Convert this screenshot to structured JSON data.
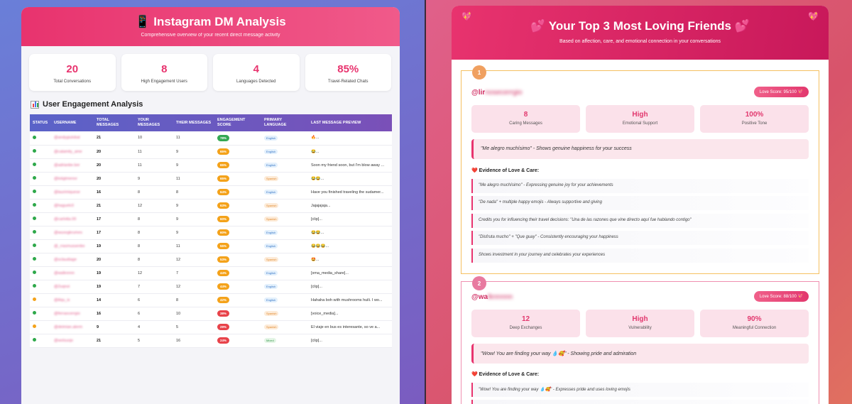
{
  "dm": {
    "title": "📱 Instagram DM Analysis",
    "subtitle": "Comprehensive overview of your recent direct message activity",
    "stats": [
      {
        "value": "20",
        "label": "Total Conversations"
      },
      {
        "value": "8",
        "label": "High Engagement Users"
      },
      {
        "value": "4",
        "label": "Languages Detected"
      },
      {
        "value": "85%",
        "label": "Travel-Related Chats"
      }
    ],
    "section_title": "User Engagement Analysis",
    "columns": [
      "STATUS",
      "USERNAME",
      "TOTAL MESSAGES",
      "YOUR MESSAGES",
      "THEIR MESSAGES",
      "ENGAGEMENT SCORE",
      "PRIMARY LANGUAGE",
      "LAST MESSAGE PREVIEW"
    ],
    "rows": [
      {
        "status": "#2ea84a",
        "username": "@andygiulobal",
        "total": "21",
        "yours": "10",
        "theirs": "11",
        "score": "78%",
        "score_color": "#34a853",
        "lang": "English",
        "preview": "🔥..."
      },
      {
        "status": "#2ea84a",
        "username": "@calamity_ame",
        "total": "20",
        "yours": "11",
        "theirs": "9",
        "score": "65%",
        "score_color": "#f4a21a",
        "lang": "English",
        "preview": "😂..."
      },
      {
        "status": "#2ea84a",
        "username": "@adrianbe.ber",
        "total": "20",
        "yours": "11",
        "theirs": "9",
        "score": "65%",
        "score_color": "#f4a21a",
        "lang": "English",
        "preview": "Soon my friend soon, but I'm blow away ..."
      },
      {
        "status": "#2ea84a",
        "username": "@toiigtmenor",
        "total": "20",
        "yours": "9",
        "theirs": "11",
        "score": "65%",
        "score_color": "#f4a21a",
        "lang": "Spanish",
        "preview": "😂😂..."
      },
      {
        "status": "#2ea84a",
        "username": "@laurimiquese",
        "total": "16",
        "yours": "8",
        "theirs": "8",
        "score": "64%",
        "score_color": "#f4a21a",
        "lang": "English",
        "preview": "Have you finished traveling the sudamer..."
      },
      {
        "status": "#2ea84a",
        "username": "@haguelc0",
        "total": "21",
        "yours": "12",
        "theirs": "9",
        "score": "63%",
        "score_color": "#f4a21a",
        "lang": "Spanish",
        "preview": "Jajajajaja..."
      },
      {
        "status": "#2ea84a",
        "username": "@carlotta.00",
        "total": "17",
        "yours": "8",
        "theirs": "9",
        "score": "60%",
        "score_color": "#f4a21a",
        "lang": "Spanish",
        "preview": "[clip]..."
      },
      {
        "status": "#2ea84a",
        "username": "@wuoogkrumes",
        "total": "17",
        "yours": "8",
        "theirs": "9",
        "score": "60%",
        "score_color": "#f4a21a",
        "lang": "English",
        "preview": "😂😂..."
      },
      {
        "status": "#2ea84a",
        "username": "@_rrasmussenbo",
        "total": "19",
        "yours": "8",
        "theirs": "11",
        "score": "55%",
        "score_color": "#f4a21a",
        "lang": "English",
        "preview": "😂😂😂..."
      },
      {
        "status": "#2ea84a",
        "username": "@sclaudiage",
        "total": "20",
        "yours": "8",
        "theirs": "12",
        "score": "53%",
        "score_color": "#f4a21a",
        "lang": "Spanish",
        "preview": "🤩..."
      },
      {
        "status": "#2ea84a",
        "username": "@walknnnn",
        "total": "19",
        "yours": "12",
        "theirs": "7",
        "score": "44%",
        "score_color": "#f4a21a",
        "lang": "English",
        "preview": "[xma_media_share]..."
      },
      {
        "status": "#2ea84a",
        "username": "@2uqnoi",
        "total": "19",
        "yours": "7",
        "theirs": "12",
        "score": "44%",
        "score_color": "#f4a21a",
        "lang": "English",
        "preview": "[clip]..."
      },
      {
        "status": "#f4a21a",
        "username": "@iliqu_is",
        "total": "14",
        "yours": "6",
        "theirs": "8",
        "score": "42%",
        "score_color": "#f4a21a",
        "lang": "English",
        "preview": "Hahaha boh with mushrooms huili. I wo..."
      },
      {
        "status": "#2ea84a",
        "username": "@ferraocerrgio",
        "total": "16",
        "yours": "6",
        "theirs": "10",
        "score": "38%",
        "score_color": "#e8434a",
        "lang": "Spanish",
        "preview": "[voice_media]..."
      },
      {
        "status": "#f4a21a",
        "username": "@deimian.alerm",
        "total": "9",
        "yours": "4",
        "theirs": "5",
        "score": "29%",
        "score_color": "#e8434a",
        "lang": "Spanish",
        "preview": "El viaje en bus es interesante, so ve a..."
      },
      {
        "status": "#2ea84a",
        "username": "@wolsuojo",
        "total": "21",
        "yours": "5",
        "theirs": "16",
        "score": "24%",
        "score_color": "#e8434a",
        "lang": "Mixed",
        "preview": "[clip]..."
      }
    ]
  },
  "love": {
    "title": "💕 Your Top 3 Most Loving Friends 💕",
    "subtitle": "Based on affection, care, and emotional connection in your conversations",
    "evidence_title": "❤️ Evidence of Love & Care:",
    "friends": [
      {
        "rank": "1",
        "handle_prefix": "@lir",
        "handle_blur": "nosecerrgio",
        "love_score": "Love Score: 95/100 💖",
        "metrics": [
          {
            "value": "8",
            "label": "Caring Messages"
          },
          {
            "value": "High",
            "label": "Emotional Support"
          },
          {
            "value": "100%",
            "label": "Positive Tone"
          }
        ],
        "quote": "\"Me alegro muchísimo\" - Shows genuine happiness for your success",
        "evidence": [
          "\"Me alegro muchísimo\" - Expressing genuine joy for your achievements",
          "\"De nada\" + multiple happy emojis - Always supportive and giving",
          "Credits you for influencing their travel decisions: \"Una de las razones que vine directo aquí fue hablando contigo\"",
          "\"Disfruta mucho\" + \"Que guay\" - Consistently encouraging your happiness",
          "Shows investment in your journey and celebrates your experiences"
        ]
      },
      {
        "rank": "2",
        "handle_prefix": "@wa",
        "handle_blur": "lknnnnn",
        "love_score": "Love Score: 88/100 💖",
        "metrics": [
          {
            "value": "12",
            "label": "Deep Exchanges"
          },
          {
            "value": "High",
            "label": "Vulnerability"
          },
          {
            "value": "90%",
            "label": "Meaningful Connection"
          }
        ],
        "quote": "\"Wow! You are finding your way 💧🥰\" - Showing pride and admiration",
        "evidence": [
          "\"Wow! You are finding your way 💧🥰\" - Expresses pride and uses loving emojis",
          ""
        ]
      }
    ]
  }
}
